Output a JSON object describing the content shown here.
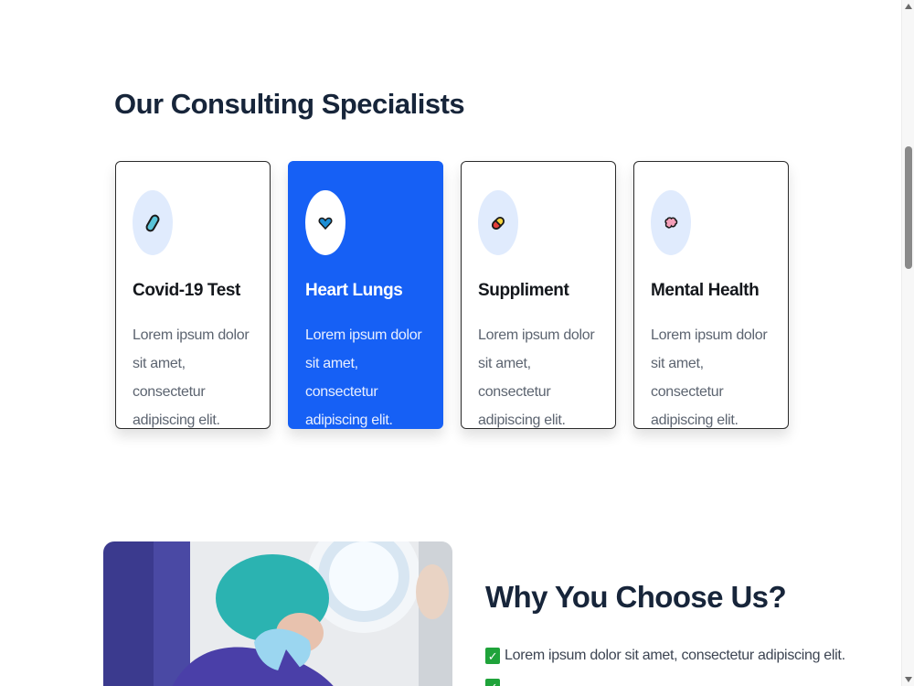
{
  "specialists": {
    "title": "Our Consulting Specialists",
    "cards": [
      {
        "title": "Covid-19 Test",
        "description": "Lorem ipsum dolor sit amet, consectetur adipiscing elit.",
        "icon": "capsule-icon",
        "active": false
      },
      {
        "title": "Heart Lungs",
        "description": "Lorem ipsum dolor sit amet, consectetur adipiscing elit.",
        "icon": "heart-icon",
        "active": true
      },
      {
        "title": "Suppliment",
        "description": "Lorem ipsum dolor sit amet, consectetur adipiscing elit.",
        "icon": "pill-icon",
        "active": false
      },
      {
        "title": "Mental Health",
        "description": "Lorem ipsum dolor sit amet, consectetur adipiscing elit.",
        "icon": "brain-icon",
        "active": false
      }
    ]
  },
  "why": {
    "title": "Why You Choose Us?",
    "items": [
      "Lorem ipsum dolor sit amet, consectetur adipiscing elit."
    ]
  },
  "colors": {
    "accent": "#1660f5",
    "icon_bg": "#e0ebfd",
    "heading": "#17253a",
    "check": "#1fa33a"
  }
}
